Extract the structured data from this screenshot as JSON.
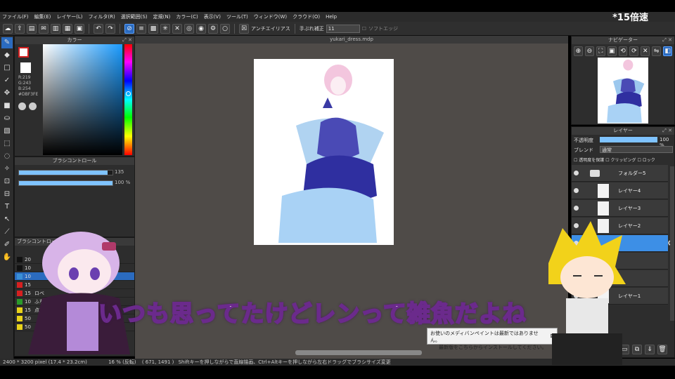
{
  "overlay": {
    "speed": "*15倍速",
    "subtitle": "いつも思ってたけどレンって雑魚だよね"
  },
  "menu": [
    "ファイル(F)",
    "編集(E)",
    "レイヤー(L)",
    "フィルタ(R)",
    "選択範囲(S)",
    "定規(N)",
    "カラー(C)",
    "表示(V)",
    "ツール(T)",
    "ウィンドウ(W)",
    "クラウド(O)",
    "Help"
  ],
  "toolbar": {
    "antialias": "アンチエイリアス",
    "stabilizer": "手ぶれ補正",
    "stabilizer_value": "11",
    "soft_edge": "ソフトエッジ"
  },
  "document": {
    "title": "yukari_dress.mdp"
  },
  "color_panel": {
    "title": "カラー",
    "r": "R:219",
    "g": "G:243",
    "b": "B:254",
    "hex": "#DBF3FE"
  },
  "brush_control": {
    "title": "ブラシコントロール",
    "size": "135",
    "opacity": "100 %",
    "size_fraction": 0.95,
    "opacity_fraction": 1.0
  },
  "brush_list": {
    "title": "ブラシコントロール",
    "items": [
      {
        "size": "20",
        "name": "",
        "color": "#111111"
      },
      {
        "size": "10",
        "name": "",
        "color": "#111111"
      },
      {
        "size": "10",
        "name": "",
        "color": "#3a8fd6"
      },
      {
        "size": "15",
        "name": "",
        "color": "#d62020"
      },
      {
        "size": "15",
        "name": "ロベ",
        "color": "#d62020"
      },
      {
        "size": "10",
        "name": "ふち",
        "color": "#2a9a2a"
      },
      {
        "size": "15",
        "name": "点描",
        "color": "#e8d21a"
      },
      {
        "size": "50",
        "name": "",
        "color": "#e8d21a"
      },
      {
        "size": "50",
        "name": "",
        "color": "#e8d21a"
      }
    ]
  },
  "navigator": {
    "title": "ナビゲーター"
  },
  "layers": {
    "title": "レイヤー",
    "opacity_label": "不透明度",
    "opacity_value": "100 %",
    "blend_label": "ブレンド",
    "blend_value": "通常",
    "protect_label": "透明度を保護",
    "clipping_label": "クリッピング",
    "lock_label": "ロック",
    "items": [
      {
        "name": "フォルダー5"
      },
      {
        "name": "レイヤー4"
      },
      {
        "name": "レイヤー3"
      },
      {
        "name": "レイヤー2"
      },
      {
        "name": ""
      },
      {
        "name": ""
      },
      {
        "name": ""
      },
      {
        "name": "レイヤー1"
      }
    ]
  },
  "status": {
    "size": "2400 * 3200 pixel  (17.4 * 23.2cm)",
    "zoom": "16 % (反転)",
    "coords": "( 671, 1491 )",
    "hint": "Shiftキーを押しながらで直線描画、Ctrl+Altキーを押しながら左右ドラッグでブラシサイズ変更"
  },
  "notice": {
    "line1": "お使いのメディバンペイントは最新ではありません。",
    "line2": "最新版をこちらからインストールしてください。"
  },
  "colors": {
    "accent": "#2b6bbf",
    "canvas_bg": "#4f4b48",
    "selected_layer": "#3d8fe6"
  }
}
